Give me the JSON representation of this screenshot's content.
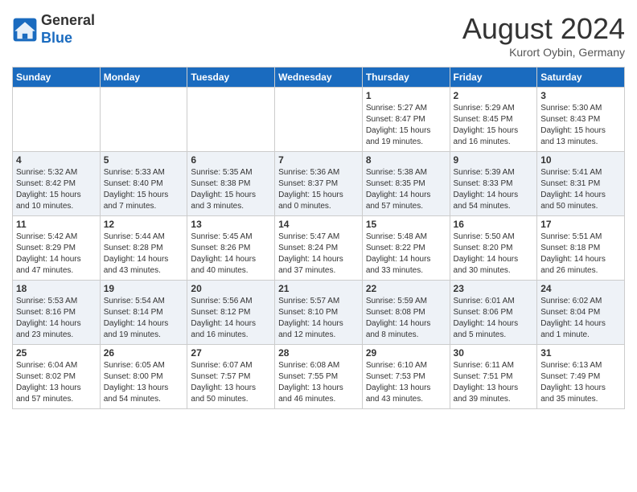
{
  "header": {
    "logo_line1": "General",
    "logo_line2": "Blue",
    "month_title": "August 2024",
    "location": "Kurort Oybin, Germany"
  },
  "weekdays": [
    "Sunday",
    "Monday",
    "Tuesday",
    "Wednesday",
    "Thursday",
    "Friday",
    "Saturday"
  ],
  "weeks": [
    [
      {
        "day": "",
        "info": ""
      },
      {
        "day": "",
        "info": ""
      },
      {
        "day": "",
        "info": ""
      },
      {
        "day": "",
        "info": ""
      },
      {
        "day": "1",
        "info": "Sunrise: 5:27 AM\nSunset: 8:47 PM\nDaylight: 15 hours\nand 19 minutes."
      },
      {
        "day": "2",
        "info": "Sunrise: 5:29 AM\nSunset: 8:45 PM\nDaylight: 15 hours\nand 16 minutes."
      },
      {
        "day": "3",
        "info": "Sunrise: 5:30 AM\nSunset: 8:43 PM\nDaylight: 15 hours\nand 13 minutes."
      }
    ],
    [
      {
        "day": "4",
        "info": "Sunrise: 5:32 AM\nSunset: 8:42 PM\nDaylight: 15 hours\nand 10 minutes."
      },
      {
        "day": "5",
        "info": "Sunrise: 5:33 AM\nSunset: 8:40 PM\nDaylight: 15 hours\nand 7 minutes."
      },
      {
        "day": "6",
        "info": "Sunrise: 5:35 AM\nSunset: 8:38 PM\nDaylight: 15 hours\nand 3 minutes."
      },
      {
        "day": "7",
        "info": "Sunrise: 5:36 AM\nSunset: 8:37 PM\nDaylight: 15 hours\nand 0 minutes."
      },
      {
        "day": "8",
        "info": "Sunrise: 5:38 AM\nSunset: 8:35 PM\nDaylight: 14 hours\nand 57 minutes."
      },
      {
        "day": "9",
        "info": "Sunrise: 5:39 AM\nSunset: 8:33 PM\nDaylight: 14 hours\nand 54 minutes."
      },
      {
        "day": "10",
        "info": "Sunrise: 5:41 AM\nSunset: 8:31 PM\nDaylight: 14 hours\nand 50 minutes."
      }
    ],
    [
      {
        "day": "11",
        "info": "Sunrise: 5:42 AM\nSunset: 8:29 PM\nDaylight: 14 hours\nand 47 minutes."
      },
      {
        "day": "12",
        "info": "Sunrise: 5:44 AM\nSunset: 8:28 PM\nDaylight: 14 hours\nand 43 minutes."
      },
      {
        "day": "13",
        "info": "Sunrise: 5:45 AM\nSunset: 8:26 PM\nDaylight: 14 hours\nand 40 minutes."
      },
      {
        "day": "14",
        "info": "Sunrise: 5:47 AM\nSunset: 8:24 PM\nDaylight: 14 hours\nand 37 minutes."
      },
      {
        "day": "15",
        "info": "Sunrise: 5:48 AM\nSunset: 8:22 PM\nDaylight: 14 hours\nand 33 minutes."
      },
      {
        "day": "16",
        "info": "Sunrise: 5:50 AM\nSunset: 8:20 PM\nDaylight: 14 hours\nand 30 minutes."
      },
      {
        "day": "17",
        "info": "Sunrise: 5:51 AM\nSunset: 8:18 PM\nDaylight: 14 hours\nand 26 minutes."
      }
    ],
    [
      {
        "day": "18",
        "info": "Sunrise: 5:53 AM\nSunset: 8:16 PM\nDaylight: 14 hours\nand 23 minutes."
      },
      {
        "day": "19",
        "info": "Sunrise: 5:54 AM\nSunset: 8:14 PM\nDaylight: 14 hours\nand 19 minutes."
      },
      {
        "day": "20",
        "info": "Sunrise: 5:56 AM\nSunset: 8:12 PM\nDaylight: 14 hours\nand 16 minutes."
      },
      {
        "day": "21",
        "info": "Sunrise: 5:57 AM\nSunset: 8:10 PM\nDaylight: 14 hours\nand 12 minutes."
      },
      {
        "day": "22",
        "info": "Sunrise: 5:59 AM\nSunset: 8:08 PM\nDaylight: 14 hours\nand 8 minutes."
      },
      {
        "day": "23",
        "info": "Sunrise: 6:01 AM\nSunset: 8:06 PM\nDaylight: 14 hours\nand 5 minutes."
      },
      {
        "day": "24",
        "info": "Sunrise: 6:02 AM\nSunset: 8:04 PM\nDaylight: 14 hours\nand 1 minute."
      }
    ],
    [
      {
        "day": "25",
        "info": "Sunrise: 6:04 AM\nSunset: 8:02 PM\nDaylight: 13 hours\nand 57 minutes."
      },
      {
        "day": "26",
        "info": "Sunrise: 6:05 AM\nSunset: 8:00 PM\nDaylight: 13 hours\nand 54 minutes."
      },
      {
        "day": "27",
        "info": "Sunrise: 6:07 AM\nSunset: 7:57 PM\nDaylight: 13 hours\nand 50 minutes."
      },
      {
        "day": "28",
        "info": "Sunrise: 6:08 AM\nSunset: 7:55 PM\nDaylight: 13 hours\nand 46 minutes."
      },
      {
        "day": "29",
        "info": "Sunrise: 6:10 AM\nSunset: 7:53 PM\nDaylight: 13 hours\nand 43 minutes."
      },
      {
        "day": "30",
        "info": "Sunrise: 6:11 AM\nSunset: 7:51 PM\nDaylight: 13 hours\nand 39 minutes."
      },
      {
        "day": "31",
        "info": "Sunrise: 6:13 AM\nSunset: 7:49 PM\nDaylight: 13 hours\nand 35 minutes."
      }
    ]
  ]
}
